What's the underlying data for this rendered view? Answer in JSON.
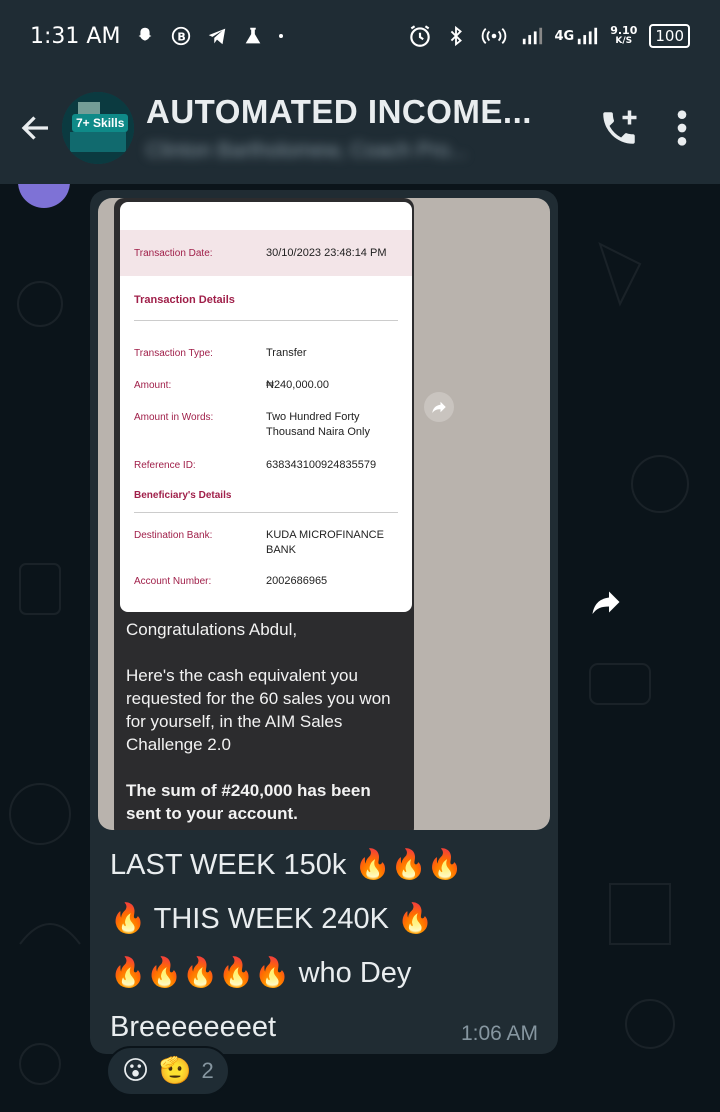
{
  "status_bar": {
    "time": "1:31 AM",
    "network_type": "4G",
    "net_speed_value": "9.10",
    "net_speed_unit": "K/S",
    "battery": "100",
    "icons": [
      "snapchat-icon",
      "bbm-icon",
      "telegram-icon",
      "flask-icon",
      "dot-icon",
      "alarm-icon",
      "bluetooth-icon",
      "hotspot-icon",
      "signal-icon",
      "signal-icon"
    ]
  },
  "header": {
    "title": "AUTOMATED INCOME...",
    "subtitle": "Clinton Bartholomew, Coach Pro...",
    "avatar_text": "7+ Skills"
  },
  "message": {
    "receipt": {
      "transaction_date_label": "Transaction Date:",
      "transaction_date_value": "30/10/2023 23:48:14 PM",
      "transaction_details_title": "Transaction Details",
      "transaction_type_label": "Transaction Type:",
      "transaction_type_value": "Transfer",
      "amount_label": "Amount:",
      "amount_value": "₦240,000.00",
      "amount_words_label": "Amount in Words:",
      "amount_words_value": "Two Hundred Forty Thousand  Naira Only",
      "reference_label": "Reference ID:",
      "reference_value": "638343100924835579",
      "beneficiary_title": "Beneficiary's Details",
      "dest_bank_label": "Destination Bank:",
      "dest_bank_value": "KUDA MICROFINANCE BANK",
      "account_number_label": "Account Number:",
      "account_number_value": "2002686965"
    },
    "image_text": {
      "greeting": "Congratulations Abdul,",
      "body": "Here's the cash equivalent you requested for the 60 sales you won for yourself, in the AIM Sales Challenge 2.0",
      "closing": "The sum of #240,000 has been sent to your account."
    },
    "caption_line1": "LAST WEEK 150k 🔥🔥🔥",
    "caption_line2": "🔥 THIS WEEK 240K 🔥",
    "caption_line3": "🔥🔥🔥🔥🔥 who Dey",
    "caption_line4": "Breeeeeeeet",
    "time": "1:06 AM",
    "reactions": {
      "emoji1": "😮",
      "emoji2": "🫡",
      "count": "2"
    }
  }
}
